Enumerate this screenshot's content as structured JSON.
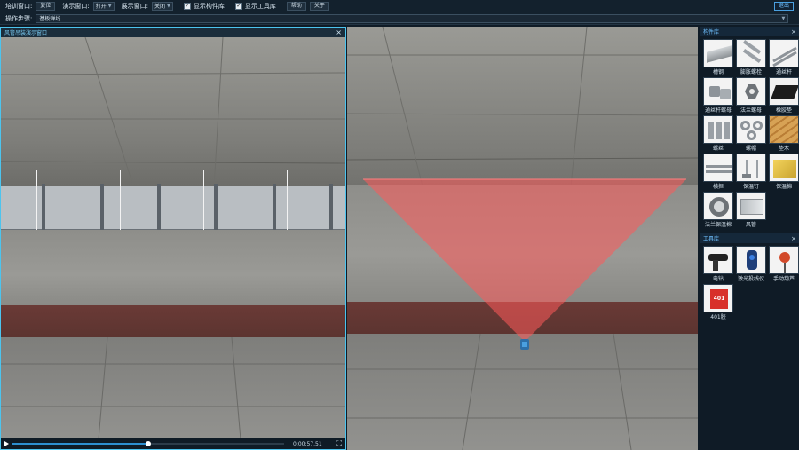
{
  "toolbar": {
    "training_window_label": "培训窗口:",
    "reset_label": "复位",
    "demo_window_label": "演示窗口:",
    "demo_window_value": "打开",
    "display_window_label": "展示窗口:",
    "display_window_value": "关闭",
    "show_components_label": "显示构件库",
    "show_tools_label": "显示工具库",
    "help_label": "帮助",
    "about_label": "关于",
    "exit_label": "退出",
    "check_mark": "✓"
  },
  "step": {
    "label": "操作步骤:",
    "value": "基板弹线"
  },
  "demo_window": {
    "title": "风管吊装演示窗口",
    "close": "×",
    "time": "0:00:57.51",
    "progress": 0.5
  },
  "components": {
    "title": "构件库",
    "close": "×",
    "items": [
      "槽钢",
      "膨胀螺栓",
      "通丝杆",
      "通丝杆螺母",
      "法兰螺母",
      "橡胶垫",
      "螺丝",
      "螺帽",
      "垫木",
      "横担",
      "保温钉",
      "保温棉",
      "法兰保温棉",
      "风管"
    ]
  },
  "tools": {
    "title": "工具库",
    "close": "×",
    "items": [
      "电钻",
      "激光投线仪",
      "手动葫芦",
      "401胶"
    ],
    "glue_label": "401"
  },
  "colors": {
    "accent": "#4cc4ee",
    "laser": "#ff5a5a",
    "progress": "#2d8fd0"
  }
}
